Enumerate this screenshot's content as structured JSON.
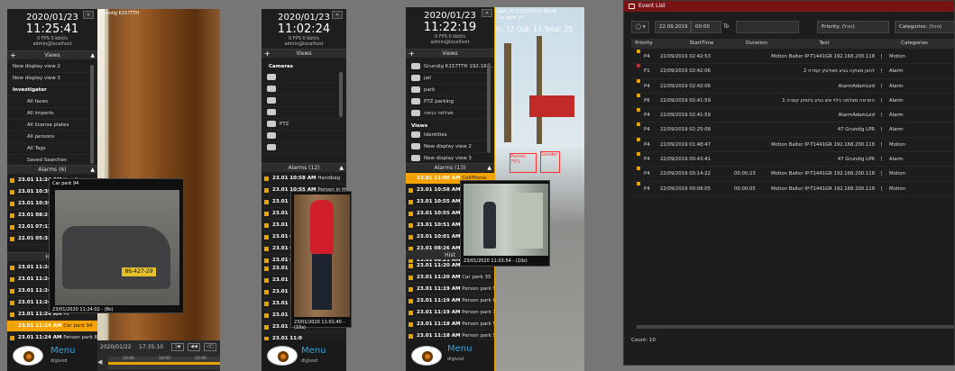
{
  "panel1": {
    "clock": {
      "date": "2020/01/23",
      "time": "11:25:41",
      "fps": "0 FPS 0 kbit/s",
      "user": "admin@localhost"
    },
    "cam_label": "Grundig K157TTH",
    "views_header": "Views",
    "views": [
      "New display view 2",
      "New display view 3"
    ],
    "group": "Investigator",
    "group_items": [
      "All faces",
      "All imports",
      "All license plates",
      "All persons",
      "All Tags",
      "Saved Searches"
    ],
    "alarms_header": "Alarms (6)",
    "alarms": [
      {
        "t": "23.01 11:24 AM",
        "n": "Handbag"
      },
      {
        "t": "23.01 10:39 AM",
        "n": ""
      },
      {
        "t": "23.01 10:39 AM",
        "n": ""
      },
      {
        "t": "23.01 08:21 AM",
        "n": ""
      },
      {
        "t": "22.01 07:12 PM",
        "n": ""
      },
      {
        "t": "22.01 05:33 PM",
        "n": ""
      }
    ],
    "history_header": "Histo",
    "history": [
      {
        "t": "23.01 11:24 AM",
        "n": "Ca"
      },
      {
        "t": "23.01 11:24 AM",
        "n": "Ca"
      },
      {
        "t": "23.01 11:24 AM",
        "n": "Pe"
      },
      {
        "t": "23.01 11:24 AM",
        "n": "Ev"
      },
      {
        "t": "23.01 11:24 AM",
        "n": "Pe"
      },
      {
        "t": "23.01 11:24 AM",
        "n": "Car park 94"
      },
      {
        "t": "23.01 11:24 AM",
        "n": "Person park 80"
      }
    ],
    "popup_title": "Car park 94",
    "popup_plate": "86-427-29",
    "popup_caption": "23/01/2020 11:24:02 - (8s)",
    "menu": "Menu",
    "menu_user": "digivod",
    "timeline_date": "2020/01/22",
    "timeline_time": "17:35:10",
    "tl_ticks": [
      "16:00",
      "18:00",
      "20:00"
    ]
  },
  "panel2": {
    "clock": {
      "date": "2020/01/23",
      "time": "11:02:24",
      "fps": "0 FPS 0 kbit/s",
      "user": "admin@localhost"
    },
    "views_header": "Views",
    "cameras_header": "Cameras",
    "cameras": [
      "",
      "",
      "",
      "",
      "PTZ",
      "",
      ""
    ],
    "alarms_header": "Alarms (12)",
    "alarms": [
      {
        "t": "23.01 10:58 AM",
        "n": "Handbag"
      },
      {
        "t": "23.01 10:55 AM",
        "n": "Person in the PTZ"
      },
      {
        "t": "23.01 10:55 AM",
        "n": ""
      },
      {
        "t": "23.01 10:51 AM",
        "n": ""
      },
      {
        "t": "23.01 10:39 AM",
        "n": ""
      },
      {
        "t": "23.01 08:2",
        "n": ""
      },
      {
        "t": "23.01 08:2",
        "n": ""
      },
      {
        "t": "23.01 08:2",
        "n": ""
      }
    ],
    "history": [
      {
        "t": "23.01 11:0",
        "n": ""
      },
      {
        "t": "23.01 11:0",
        "n": ""
      },
      {
        "t": "23.01 11:0",
        "n": ""
      },
      {
        "t": "23.01 11:0",
        "n": ""
      },
      {
        "t": "23.01 11:0",
        "n": ""
      },
      {
        "t": "23.01 11:0",
        "n": ""
      },
      {
        "t": "23.01 11:0",
        "n": ""
      }
    ],
    "popup_caption": "23/01/2020 11:01:40 - (10s)",
    "menu": "Menu",
    "menu_user": "digivod"
  },
  "panel3": {
    "clock": {
      "date": "2020/01/23",
      "time": "11:22:19",
      "fps": "0 FPS 0 kbit/s",
      "user": "admin@localhost"
    },
    "cam_label": "park 3C 23/01/2020 08:29",
    "cam_label2": "Car park 34",
    "counter": "In: 12 Out: 13 Total: 25",
    "overlay_person": "Person 75%",
    "overlay_gender": "Gender",
    "views_header": "Views",
    "cameras": [
      "Grundig K157TTH 192.168...",
      "jail",
      "park",
      "PTZ parking",
      "מצלמה כניסה"
    ],
    "views_group": "Views",
    "views": [
      "Identities",
      "New display view 2",
      "New display view 3"
    ],
    "alarms_header": "Alarms (13)",
    "alarms": [
      {
        "t": "23.01 11:00 AM",
        "n": "CellPhone"
      },
      {
        "t": "23.01 10:58 AM",
        "n": "CellPhone"
      },
      {
        "t": "23.01 10:55 AM",
        "n": ""
      },
      {
        "t": "23.01 10:55 AM",
        "n": ""
      },
      {
        "t": "23.01 10:51 AM",
        "n": ""
      },
      {
        "t": "23.01 10:01 AM",
        "n": ""
      },
      {
        "t": "23.01 08:26 AM",
        "n": ""
      },
      {
        "t": "23.01 08:21 AM",
        "n": ""
      }
    ],
    "history_header": "Hist",
    "history": [
      {
        "t": "23.01 11:20 AM",
        "n": "Car"
      },
      {
        "t": "23.01 11:20 AM",
        "n": "Car park 35"
      },
      {
        "t": "23.01 11:19 AM",
        "n": "Person park 92"
      },
      {
        "t": "23.01 11:19 AM",
        "n": "Person park 62"
      },
      {
        "t": "23.01 11:19 AM",
        "n": "Person park 36"
      },
      {
        "t": "23.01 11:18 AM",
        "n": "Person park 52"
      },
      {
        "t": "23.01 11:18 AM",
        "n": "Person park 59"
      }
    ],
    "popup_caption": "23/01/2020 11:03:54 - (10s)",
    "menu": "Menu",
    "menu_user": "digivod"
  },
  "event_list": {
    "title": "Event List",
    "filter_date": "22.09.2019",
    "filter_time": "00:00",
    "filter_to": "To",
    "priority_filter": "Priority: (הכל)",
    "category_filter": "Categories: (הכל)",
    "columns": [
      "Priority",
      "StartTime",
      "Duration",
      "Text",
      "Categories"
    ],
    "rows": [
      {
        "priority": "P4",
        "color": "#e8a200",
        "start": "22/09/2019 02:42:53",
        "duration": "",
        "text": "Motion Balter IP-T1441GR 192.168.200.118",
        "category": "Motion"
      },
      {
        "priority": "P1",
        "color": "#c0282d",
        "start": "22/09/2019 02:42:06",
        "duration": "",
        "text": "לחצן מצוקה בגיע מאלעק קמרה 2",
        "category": "Alarm"
      },
      {
        "priority": "P4",
        "color": "#e8a200",
        "start": "22/09/2019 02:42:06",
        "duration": "",
        "text": "AlarmAdamLed",
        "category": "Alarm"
      },
      {
        "priority": "P6",
        "color": "#e8a200",
        "start": "22/09/2019 02:41:59",
        "duration": "",
        "text": "התראה מצלמה גילוי אש בגיע ביטחון קמרה 1",
        "category": "Alarm"
      },
      {
        "priority": "P4",
        "color": "#e8a200",
        "start": "22/09/2019 02:41:59",
        "duration": "",
        "text": "AlarmAdamLed",
        "category": "Alarm"
      },
      {
        "priority": "P4",
        "color": "#e8a200",
        "start": "22/09/2019 02:25:08",
        "duration": "",
        "text": "47 Grundig LPR",
        "category": "Alarm"
      },
      {
        "priority": "P4",
        "color": "#e8a200",
        "start": "22/09/2019 01:48:47",
        "duration": "",
        "text": "Motion Balter IP-T1441GR 192.168.200.118",
        "category": "Motion"
      },
      {
        "priority": "P4",
        "color": "#e8a200",
        "start": "22/09/2019 00:43:41",
        "duration": "",
        "text": "47 Grundig LPR",
        "category": "Alarm"
      },
      {
        "priority": "P4",
        "color": "#e8a200",
        "start": "22/09/2019 00:14:22",
        "duration": "00:00:23",
        "text": "Motion Balter IP-T1441GR 192.168.200.118",
        "category": "Motion"
      },
      {
        "priority": "P4",
        "color": "#e8a200",
        "start": "22/09/2019 00:08:05",
        "duration": "00:00:05",
        "text": "Motion Balter IP-T1441GR 192.168.200.118",
        "category": "Motion"
      }
    ],
    "count": "Count: 10"
  }
}
